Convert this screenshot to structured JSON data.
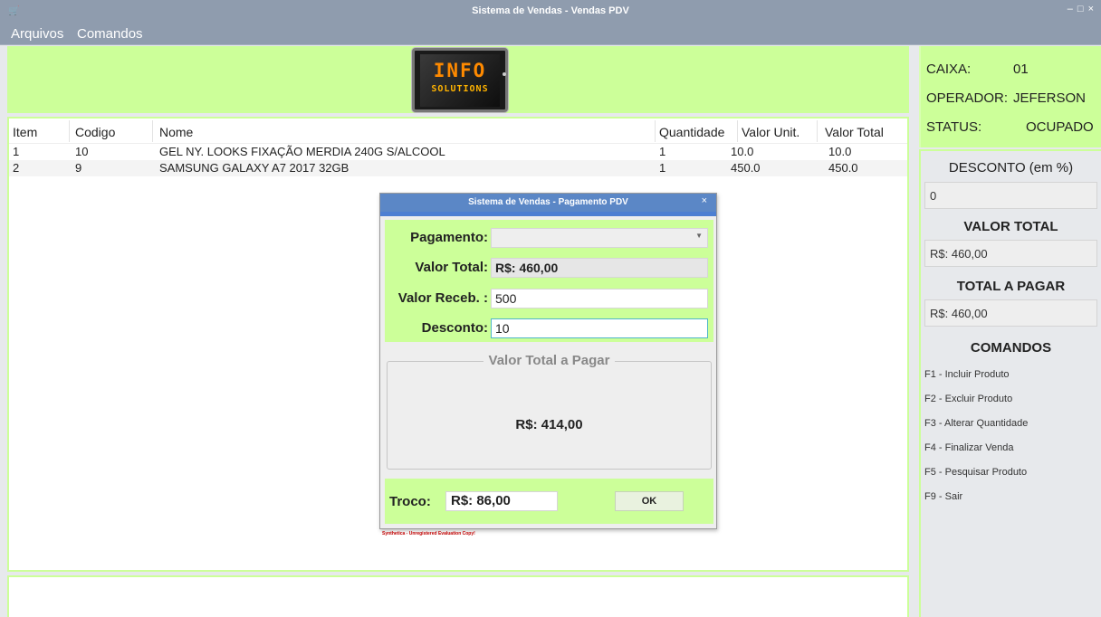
{
  "window": {
    "title": "Sistema de Vendas - Vendas PDV",
    "controls": [
      "–",
      "□",
      "×"
    ]
  },
  "menu": [
    "Arquivos",
    "Comandos"
  ],
  "logo": {
    "top": "INFO",
    "bottom": "SOLUTIONS"
  },
  "table": {
    "headers": [
      "Item",
      "Codigo",
      "Nome",
      "Quantidade",
      "Valor Unit.",
      "Valor Total"
    ],
    "rows": [
      [
        "1",
        "10",
        "GEL NY. LOOKS FIXAÇÃO MERDIA 240G S/ALCOOL",
        "1",
        "10.0",
        "10.0"
      ],
      [
        "2",
        "9",
        "SAMSUNG GALAXY A7 2017 32GB",
        "1",
        "450.0",
        "450.0"
      ]
    ]
  },
  "info": {
    "caixa_label": "CAIXA:",
    "caixa_value": "01",
    "operador_label": "OPERADOR:",
    "operador_value": "JEFERSON",
    "status_label": "STATUS:",
    "status_value": "OCUPADO"
  },
  "side": {
    "desconto_title": "DESCONTO (em %)",
    "desconto_value": "0",
    "valor_total_title": "VALOR TOTAL",
    "valor_total_value": "R$: 460,00",
    "total_pagar_title": "TOTAL A PAGAR",
    "total_pagar_value": "R$: 460,00",
    "comandos_title": "COMANDOS",
    "commands": [
      "F1 - Incluir Produto",
      "F2 - Excluir Produto",
      "F3 - Alterar Quantidade",
      "F4 - Finalizar Venda",
      "F5 - Pesquisar Produto",
      "F9 - Sair"
    ]
  },
  "dialog": {
    "title": "Sistema de Vendas - Pagamento PDV",
    "close": "×",
    "pagamento_label": "Pagamento:",
    "valor_total_label": "Valor Total:",
    "valor_total_value": "R$: 460,00",
    "valor_receb_label": "Valor Receb. :",
    "valor_receb_value": "500",
    "desconto_label": "Desconto:",
    "desconto_value": "10",
    "group_title": "Valor Total a Pagar",
    "group_value": "R$: 414,00",
    "troco_label": "Troco:",
    "troco_value": "R$: 86,00",
    "ok_label": "OK",
    "watermark": "Synthetica - Unregistered Evaluation Copy!"
  },
  "colors": {
    "accent_green": "#ccff99",
    "titlebar": "#8f9cae",
    "dialog_title": "#5b87c6"
  }
}
